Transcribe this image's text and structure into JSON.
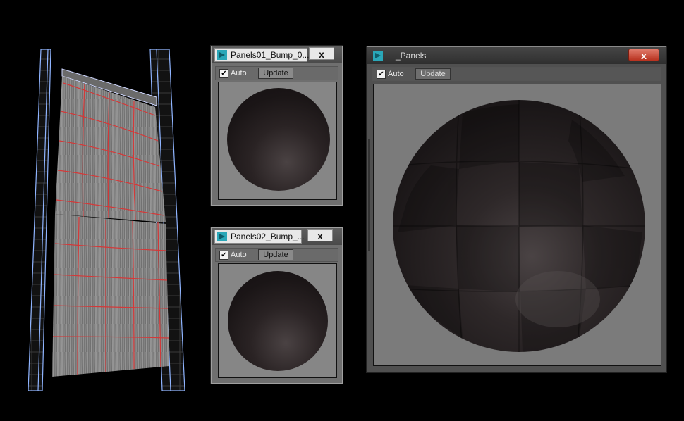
{
  "windows": {
    "panels01": {
      "title": "Panels01_Bump_0...",
      "close": "x",
      "auto_label": "Auto",
      "auto_checked": "✔",
      "update_label": "Update"
    },
    "panels02": {
      "title": "Panels02_Bump_...",
      "close": "x",
      "auto_label": "Auto",
      "auto_checked": "✔",
      "update_label": "Update"
    },
    "panels": {
      "title": "_Panels",
      "close": "x",
      "auto_label": "Auto",
      "auto_checked": "✔",
      "update_label": "Update"
    }
  },
  "icons": {
    "app": "3dsmax-icon",
    "close": "close-icon",
    "checkbox": "checkbox-checked-icon"
  },
  "colors": {
    "uv_seam": "#d43838",
    "mesh_edge": "#8fb4ff",
    "background": "#000000"
  }
}
